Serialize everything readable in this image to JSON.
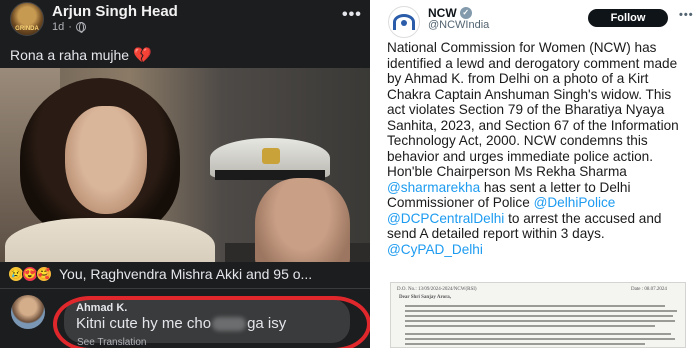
{
  "facebook": {
    "author": "Arjun Singh Head",
    "avatar_text": "GRINDA",
    "time": "1d",
    "audience_icon": "globe-icon",
    "menu_icon": "more-dots-icon",
    "menu_glyph": "•••",
    "caption": "Rona a raha mujhe",
    "caption_emoji": "💔",
    "reactions": {
      "icons": [
        "😢",
        "😍",
        "🥰"
      ],
      "text": "You, Raghvendra Mishra Akki and 95 o..."
    },
    "comment": {
      "author": "Ahmad K.",
      "text_start": "Kitni cute hy me cho",
      "text_end": "ga isy",
      "see_translation": "See Translation"
    }
  },
  "tweet": {
    "display_name": "NCW",
    "verified_glyph": "✓",
    "handle": "@NCWIndia",
    "follow_label": "Follow",
    "menu_glyph": "•••",
    "body_text": "National Commission for Women (NCW) has identified a lewd and derogatory comment made by Ahmad K. from Delhi on a photo of a Kirt Chakra Captain Anshuman Singh's widow. This act violates Section 79 of the Bharatiya Nyaya Sanhita, 2023, and Section 67 of the Information Technology Act, 2000. NCW condemns this behavior and urges immediate police action. Hon'ble Chairperson Ms Rekha Sharma",
    "mention_1": "@sharmarekha",
    "text_2": " has sent a letter to Delhi Commissioner of Police ",
    "mention_2": "@DelhiPolice",
    "mention_3": "@DCPCentralDelhi",
    "text_3": " to arrest the accused and send A detailed report within 3 days.",
    "mention_4": "@CyPAD_Delhi",
    "doc": {
      "ref": "D.O. No.: 13/09/2024-2024/NCW(RSI)",
      "date": "Date : 08.07.2024",
      "salutation": "Dear Shri Sanjay Arora,"
    }
  },
  "colors": {
    "facebook_bg": "#1c1d1f",
    "highlight_circle": "#e0282c",
    "mention_blue": "#1d9bf0",
    "ncw_blue": "#2a5caa"
  }
}
